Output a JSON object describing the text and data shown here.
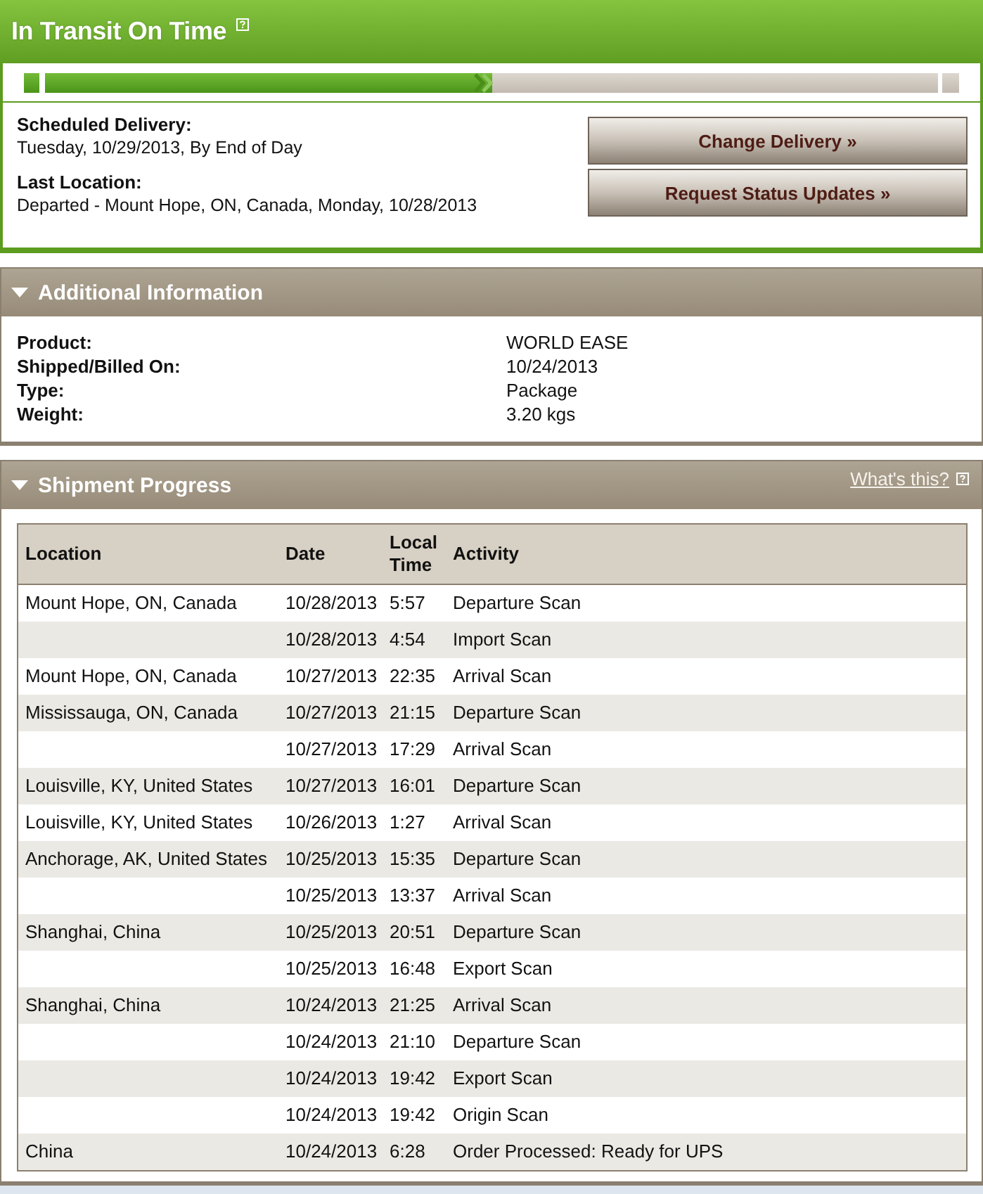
{
  "status": {
    "title": "In Transit On Time",
    "progress": {
      "level": 0.5
    }
  },
  "delivery": {
    "fields": [
      {
        "label": "Scheduled Delivery:",
        "value": "Tuesday, 10/29/2013, By End of Day"
      },
      {
        "label": "Last Location:",
        "value": "Departed - Mount Hope, ON, Canada, Monday, 10/28/2013"
      }
    ],
    "buttons": [
      {
        "label": "Change Delivery »"
      },
      {
        "label": "Request Status Updates »"
      }
    ]
  },
  "additional_information": {
    "title": "Additional Information",
    "expanded": true,
    "rows": [
      {
        "label": "Product:",
        "value": "WORLD EASE"
      },
      {
        "label": "Shipped/Billed On:",
        "value": "10/24/2013"
      },
      {
        "label": "Type:",
        "value": "Package"
      },
      {
        "label": "Weight:",
        "value": "3.20 kgs"
      }
    ]
  },
  "shipment_progress": {
    "title": "Shipment Progress",
    "expanded": true,
    "help_link": "What's this?",
    "table": {
      "columns": [
        "Location",
        "Date",
        "Local Time",
        "Activity"
      ],
      "rows": [
        {
          "location": "Mount Hope, ON, Canada",
          "date": "10/28/2013",
          "local_time": "5:57",
          "activity": "Departure Scan"
        },
        {
          "date": "10/28/2013",
          "local_time": "4:54",
          "activity": "Import Scan"
        },
        {
          "location": "Mount Hope, ON, Canada",
          "date": "10/27/2013",
          "local_time": "22:35",
          "activity": "Arrival Scan"
        },
        {
          "location": "Mississauga, ON, Canada",
          "date": "10/27/2013",
          "local_time": "21:15",
          "activity": "Departure Scan"
        },
        {
          "date": "10/27/2013",
          "local_time": "17:29",
          "activity": "Arrival Scan"
        },
        {
          "location": "Louisville, KY, United States",
          "date": "10/27/2013",
          "local_time": "16:01",
          "activity": "Departure Scan"
        },
        {
          "location": "Louisville, KY, United States",
          "date": "10/26/2013",
          "local_time": "1:27",
          "activity": "Arrival Scan"
        },
        {
          "location": "Anchorage, AK, United States",
          "date": "10/25/2013",
          "local_time": "15:35",
          "activity": "Departure Scan"
        },
        {
          "date": "10/25/2013",
          "local_time": "13:37",
          "activity": "Arrival Scan"
        },
        {
          "location": "Shanghai, China",
          "date": "10/25/2013",
          "local_time": "20:51",
          "activity": "Departure Scan"
        },
        {
          "date": "10/25/2013",
          "local_time": "16:48",
          "activity": "Export Scan"
        },
        {
          "location": "Shanghai, China",
          "date": "10/24/2013",
          "local_time": "21:25",
          "activity": "Arrival Scan"
        },
        {
          "date": "10/24/2013",
          "local_time": "21:10",
          "activity": "Departure Scan"
        },
        {
          "date": "10/24/2013",
          "local_time": "19:42",
          "activity": "Export Scan"
        },
        {
          "date": "10/24/2013",
          "local_time": "19:42",
          "activity": "Origin Scan"
        },
        {
          "location": "China",
          "date": "10/24/2013",
          "local_time": "6:28",
          "activity": "Order Processed: Ready for UPS"
        }
      ]
    }
  }
}
